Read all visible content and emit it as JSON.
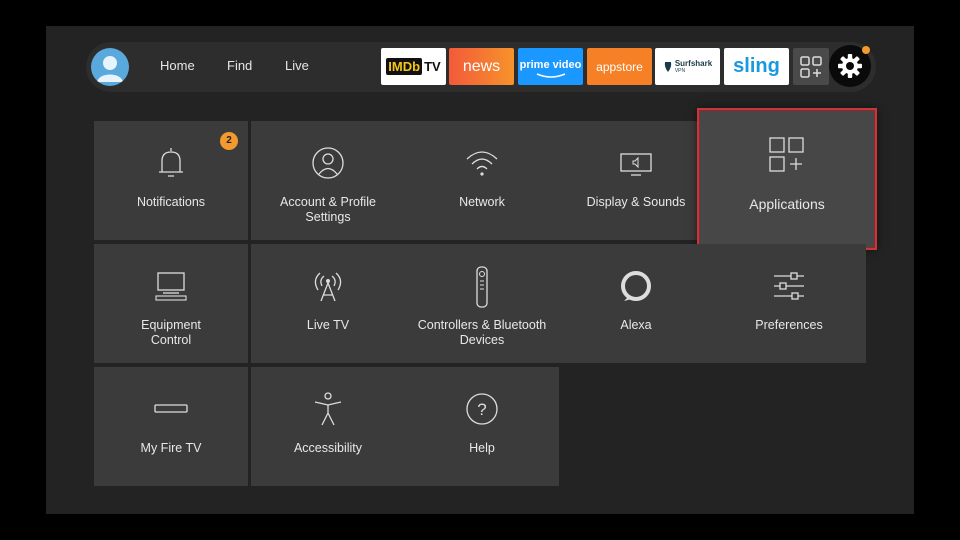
{
  "nav": {
    "home": "Home",
    "find": "Find",
    "live": "Live"
  },
  "apps": [
    {
      "id": "imdbtv",
      "label_a": "IMDb",
      "label_b": "TV",
      "bg": "#ffffff"
    },
    {
      "id": "news",
      "label": "news",
      "bg": "#f3752b"
    },
    {
      "id": "prime",
      "label": "prime video",
      "bg": "#1a98ff"
    },
    {
      "id": "appstore",
      "label": "appstore",
      "bg": "#f58025"
    },
    {
      "id": "surfshark",
      "label": "Surfshark",
      "sub": "VPN",
      "bg": "#ffffff"
    },
    {
      "id": "sling",
      "label": "sling",
      "bg": "#ffffff"
    }
  ],
  "notification_count": "2",
  "tiles": [
    {
      "id": "notifications",
      "label": "Notifications"
    },
    {
      "id": "account",
      "label": "Account & Profile\nSettings"
    },
    {
      "id": "network",
      "label": "Network"
    },
    {
      "id": "display",
      "label": "Display & Sounds"
    },
    {
      "id": "applications",
      "label": "Applications"
    },
    {
      "id": "equipment",
      "label": "Equipment\nControl"
    },
    {
      "id": "livetv",
      "label": "Live TV"
    },
    {
      "id": "controllers",
      "label": "Controllers & Bluetooth\nDevices"
    },
    {
      "id": "alexa",
      "label": "Alexa"
    },
    {
      "id": "preferences",
      "label": "Preferences"
    },
    {
      "id": "myfiretv",
      "label": "My Fire TV"
    },
    {
      "id": "accessibility",
      "label": "Accessibility"
    },
    {
      "id": "help",
      "label": "Help"
    }
  ],
  "colors": {
    "focus_outline": "#c9373d",
    "badge": "#f29a2e",
    "tile_bg": "#3b3b3b"
  }
}
